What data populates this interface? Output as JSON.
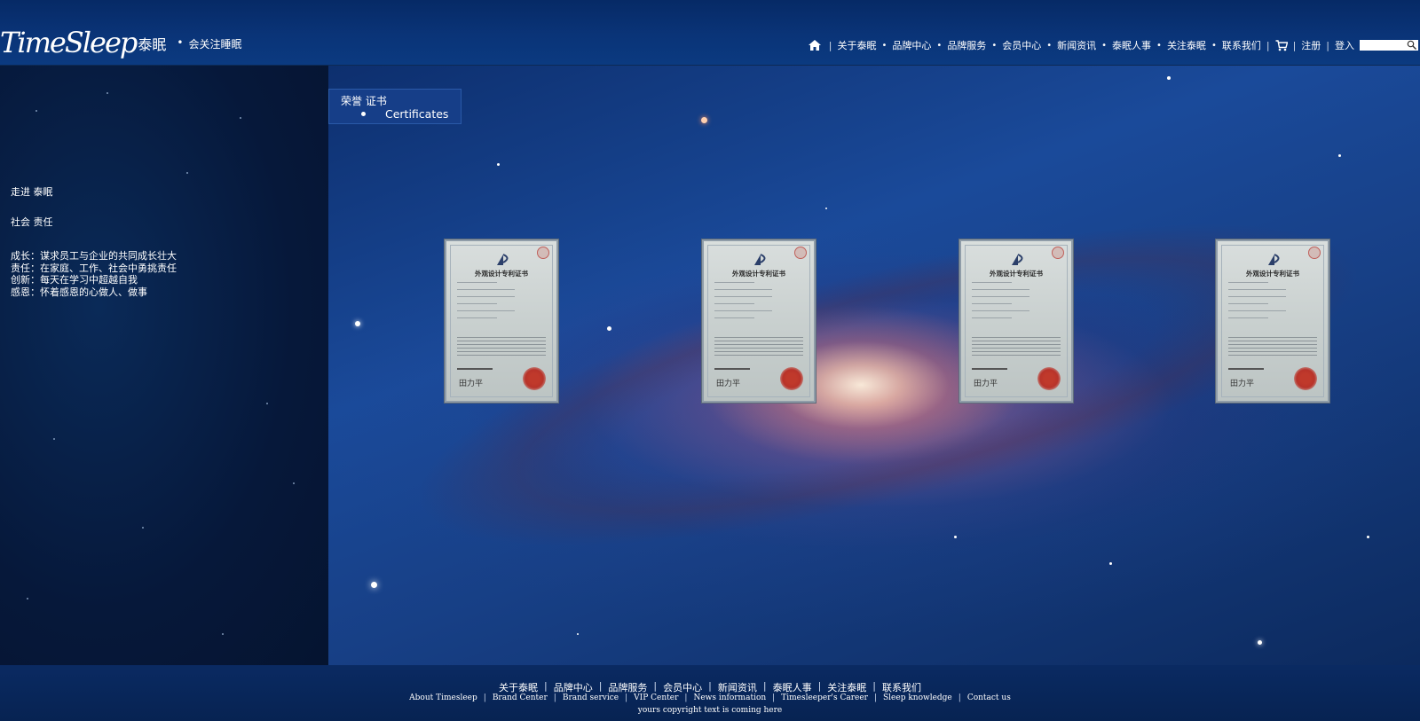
{
  "brand": {
    "logo_text": "TimeSleep",
    "logo_cn": "泰眠",
    "tagline": "会关注睡眠"
  },
  "nav": {
    "items": [
      "关于泰眠",
      "品牌中心",
      "品牌服务",
      "会员中心",
      "新闻资讯",
      "泰眠人事",
      "关注泰眠",
      "联系我们"
    ],
    "register": "注册",
    "login": "登入",
    "search_placeholder": ""
  },
  "sidebar": {
    "links": [
      "走进 泰眠",
      "社会 责任"
    ],
    "values": [
      "成长：谋求员工与企业的共同成长壮大",
      "责任：在家庭、工作、社会中勇挑责任",
      "创新：每天在学习中超越自我",
      "感恩：怀着感恩的心做人、做事"
    ]
  },
  "section": {
    "title": "荣誉 证书",
    "subitem": "Certificates"
  },
  "certificates": [
    {
      "title": "外观设计专利证书",
      "signature": "田力平"
    },
    {
      "title": "外观设计专利证书",
      "signature": "田力平"
    },
    {
      "title": "外观设计专利证书",
      "signature": "田力平"
    },
    {
      "title": "外观设计专利证书",
      "signature": "田力平"
    }
  ],
  "footer": {
    "cn_links": [
      "关于泰眠",
      "品牌中心",
      "品牌服务",
      "会员中心",
      "新闻资讯",
      "泰眠人事",
      "关注泰眠",
      "联系我们"
    ],
    "en_links": [
      "About Timesleep",
      "Brand Center",
      "Brand service",
      "VIP Center",
      "News information",
      "Timesleeper's Career",
      "Sleep knowledge",
      "Contact us"
    ],
    "copyright": "yours copyright text is coming here"
  }
}
